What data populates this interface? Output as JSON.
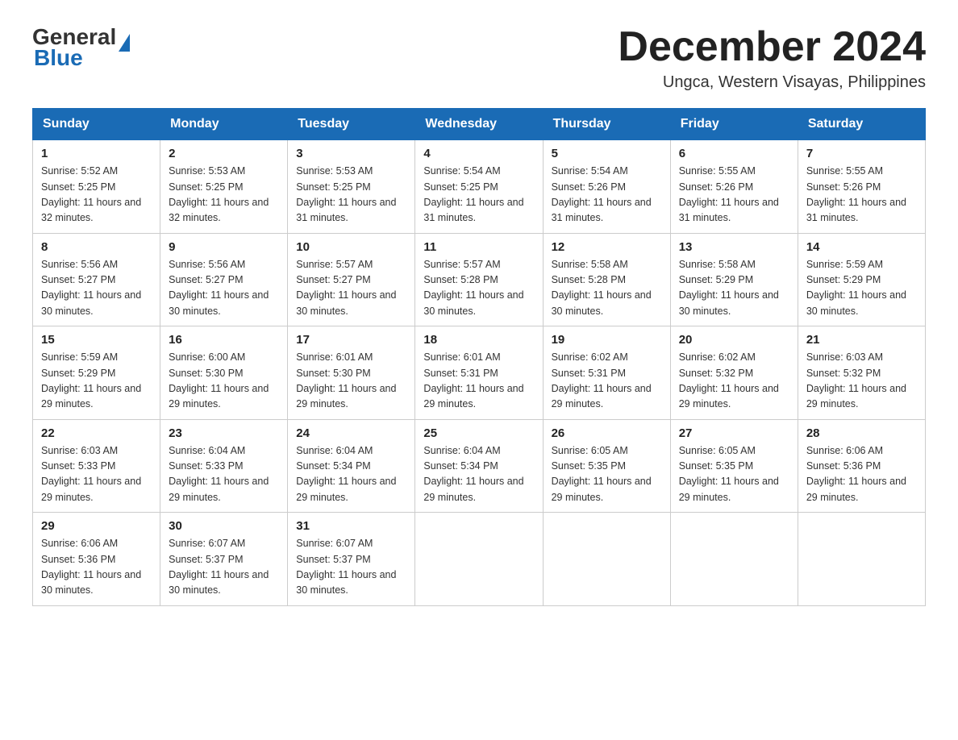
{
  "header": {
    "logo_general": "General",
    "logo_blue": "Blue",
    "month_year": "December 2024",
    "location": "Ungca, Western Visayas, Philippines"
  },
  "days_of_week": [
    "Sunday",
    "Monday",
    "Tuesday",
    "Wednesday",
    "Thursday",
    "Friday",
    "Saturday"
  ],
  "weeks": [
    [
      {
        "day": "1",
        "sunrise": "5:52 AM",
        "sunset": "5:25 PM",
        "daylight": "11 hours and 32 minutes."
      },
      {
        "day": "2",
        "sunrise": "5:53 AM",
        "sunset": "5:25 PM",
        "daylight": "11 hours and 32 minutes."
      },
      {
        "day": "3",
        "sunrise": "5:53 AM",
        "sunset": "5:25 PM",
        "daylight": "11 hours and 31 minutes."
      },
      {
        "day": "4",
        "sunrise": "5:54 AM",
        "sunset": "5:25 PM",
        "daylight": "11 hours and 31 minutes."
      },
      {
        "day": "5",
        "sunrise": "5:54 AM",
        "sunset": "5:26 PM",
        "daylight": "11 hours and 31 minutes."
      },
      {
        "day": "6",
        "sunrise": "5:55 AM",
        "sunset": "5:26 PM",
        "daylight": "11 hours and 31 minutes."
      },
      {
        "day": "7",
        "sunrise": "5:55 AM",
        "sunset": "5:26 PM",
        "daylight": "11 hours and 31 minutes."
      }
    ],
    [
      {
        "day": "8",
        "sunrise": "5:56 AM",
        "sunset": "5:27 PM",
        "daylight": "11 hours and 30 minutes."
      },
      {
        "day": "9",
        "sunrise": "5:56 AM",
        "sunset": "5:27 PM",
        "daylight": "11 hours and 30 minutes."
      },
      {
        "day": "10",
        "sunrise": "5:57 AM",
        "sunset": "5:27 PM",
        "daylight": "11 hours and 30 minutes."
      },
      {
        "day": "11",
        "sunrise": "5:57 AM",
        "sunset": "5:28 PM",
        "daylight": "11 hours and 30 minutes."
      },
      {
        "day": "12",
        "sunrise": "5:58 AM",
        "sunset": "5:28 PM",
        "daylight": "11 hours and 30 minutes."
      },
      {
        "day": "13",
        "sunrise": "5:58 AM",
        "sunset": "5:29 PM",
        "daylight": "11 hours and 30 minutes."
      },
      {
        "day": "14",
        "sunrise": "5:59 AM",
        "sunset": "5:29 PM",
        "daylight": "11 hours and 30 minutes."
      }
    ],
    [
      {
        "day": "15",
        "sunrise": "5:59 AM",
        "sunset": "5:29 PM",
        "daylight": "11 hours and 29 minutes."
      },
      {
        "day": "16",
        "sunrise": "6:00 AM",
        "sunset": "5:30 PM",
        "daylight": "11 hours and 29 minutes."
      },
      {
        "day": "17",
        "sunrise": "6:01 AM",
        "sunset": "5:30 PM",
        "daylight": "11 hours and 29 minutes."
      },
      {
        "day": "18",
        "sunrise": "6:01 AM",
        "sunset": "5:31 PM",
        "daylight": "11 hours and 29 minutes."
      },
      {
        "day": "19",
        "sunrise": "6:02 AM",
        "sunset": "5:31 PM",
        "daylight": "11 hours and 29 minutes."
      },
      {
        "day": "20",
        "sunrise": "6:02 AM",
        "sunset": "5:32 PM",
        "daylight": "11 hours and 29 minutes."
      },
      {
        "day": "21",
        "sunrise": "6:03 AM",
        "sunset": "5:32 PM",
        "daylight": "11 hours and 29 minutes."
      }
    ],
    [
      {
        "day": "22",
        "sunrise": "6:03 AM",
        "sunset": "5:33 PM",
        "daylight": "11 hours and 29 minutes."
      },
      {
        "day": "23",
        "sunrise": "6:04 AM",
        "sunset": "5:33 PM",
        "daylight": "11 hours and 29 minutes."
      },
      {
        "day": "24",
        "sunrise": "6:04 AM",
        "sunset": "5:34 PM",
        "daylight": "11 hours and 29 minutes."
      },
      {
        "day": "25",
        "sunrise": "6:04 AM",
        "sunset": "5:34 PM",
        "daylight": "11 hours and 29 minutes."
      },
      {
        "day": "26",
        "sunrise": "6:05 AM",
        "sunset": "5:35 PM",
        "daylight": "11 hours and 29 minutes."
      },
      {
        "day": "27",
        "sunrise": "6:05 AM",
        "sunset": "5:35 PM",
        "daylight": "11 hours and 29 minutes."
      },
      {
        "day": "28",
        "sunrise": "6:06 AM",
        "sunset": "5:36 PM",
        "daylight": "11 hours and 29 minutes."
      }
    ],
    [
      {
        "day": "29",
        "sunrise": "6:06 AM",
        "sunset": "5:36 PM",
        "daylight": "11 hours and 30 minutes."
      },
      {
        "day": "30",
        "sunrise": "6:07 AM",
        "sunset": "5:37 PM",
        "daylight": "11 hours and 30 minutes."
      },
      {
        "day": "31",
        "sunrise": "6:07 AM",
        "sunset": "5:37 PM",
        "daylight": "11 hours and 30 minutes."
      },
      null,
      null,
      null,
      null
    ]
  ],
  "labels": {
    "sunrise_prefix": "Sunrise: ",
    "sunset_prefix": "Sunset: ",
    "daylight_prefix": "Daylight: "
  }
}
